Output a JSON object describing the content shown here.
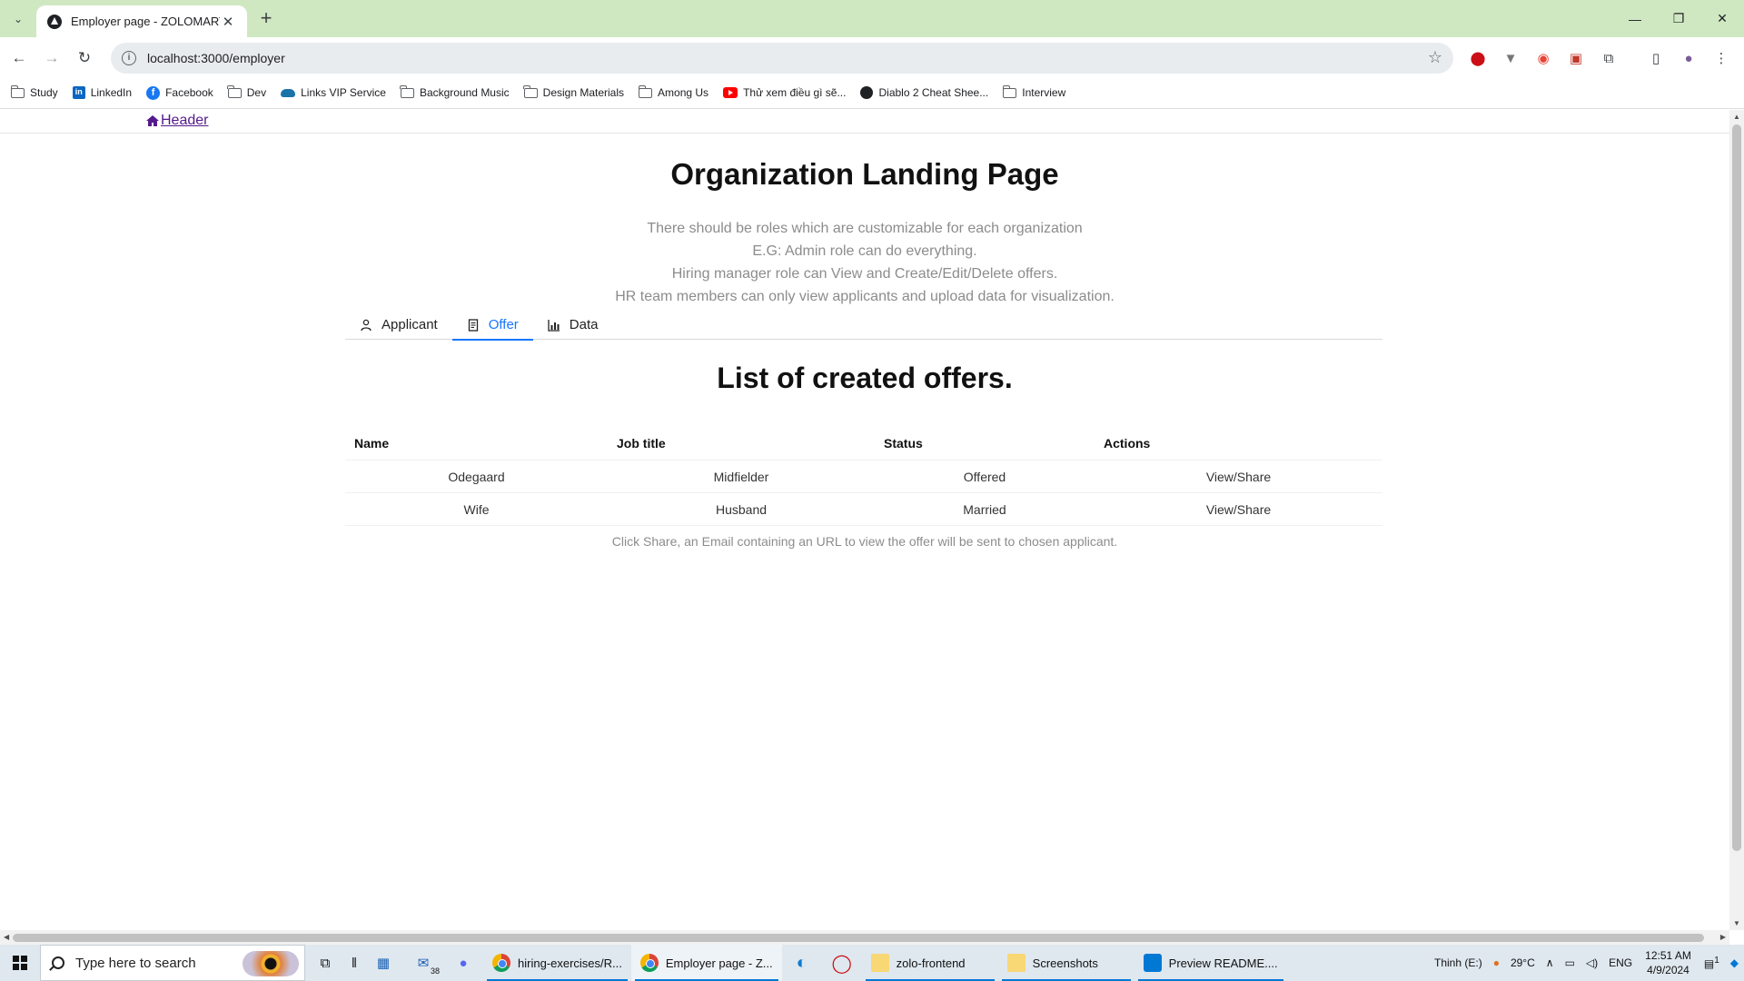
{
  "browser": {
    "tab_title": "Employer page - ZOLOMART",
    "url": "localhost:3000/employer",
    "bookmarks": [
      {
        "label": "Study",
        "icon": "folder-icon"
      },
      {
        "label": "LinkedIn",
        "icon": "linkedin-icon"
      },
      {
        "label": "Facebook",
        "icon": "facebook-icon"
      },
      {
        "label": "Dev",
        "icon": "folder-icon"
      },
      {
        "label": "Links VIP Service",
        "icon": "cloud-icon"
      },
      {
        "label": "Background Music",
        "icon": "folder-icon"
      },
      {
        "label": "Design Materials",
        "icon": "folder-icon"
      },
      {
        "label": "Among Us",
        "icon": "folder-icon"
      },
      {
        "label": "Thử xem điều gì sẽ...",
        "icon": "youtube-icon"
      },
      {
        "label": "Diablo 2 Cheat Shee...",
        "icon": "globe-icon"
      },
      {
        "label": "Interview",
        "icon": "folder-icon"
      }
    ]
  },
  "page": {
    "header_link": "Header",
    "title": "Organization Landing Page",
    "description": [
      "There should be roles which are customizable for each organization",
      "E.G: Admin role can do everything.",
      "Hiring manager role can View and Create/Edit/Delete offers.",
      "HR team members can only view applicants and upload data for visualization."
    ],
    "tabs": [
      {
        "label": "Applicant",
        "icon": "user-icon"
      },
      {
        "label": "Offer",
        "icon": "file-icon"
      },
      {
        "label": "Data",
        "icon": "bar-chart-icon"
      }
    ],
    "active_tab": "Offer",
    "subtitle": "List of created offers.",
    "table": {
      "headers": [
        "Name",
        "Job title",
        "Status",
        "Actions"
      ],
      "rows": [
        [
          "Odegaard",
          "Midfielder",
          "Offered",
          "View/Share"
        ],
        [
          "Wife",
          "Husband",
          "Married",
          "View/Share"
        ]
      ]
    },
    "note": "Click Share, an Email containing an URL to view the offer will be sent to chosen applicant."
  },
  "taskbar": {
    "search_placeholder": "Type here to search",
    "mail_badge": "38",
    "apps": [
      {
        "label": "hiring-exercises/R...",
        "icon": "chrome-icon"
      },
      {
        "label": "Employer page - Z...",
        "icon": "chrome-icon"
      },
      {
        "label": "zolo-frontend",
        "icon": "folder-icon"
      },
      {
        "label": "Screenshots",
        "icon": "folder-icon"
      },
      {
        "label": "Preview README....",
        "icon": "vscode-icon"
      }
    ],
    "drive_label": "Thinh (E:)",
    "temperature": "29°C",
    "language": "ENG",
    "time": "12:51 AM",
    "date": "4/9/2024",
    "notification_count": "1"
  },
  "colors": {
    "tab_strip": "#cfe8c2",
    "accent": "#1677ff",
    "link_visited": "#551a8b",
    "muted_text": "#8c8c8c"
  }
}
